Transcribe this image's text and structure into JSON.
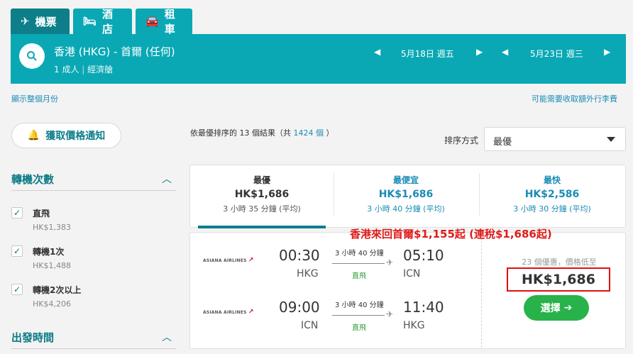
{
  "tabs": [
    {
      "label": "機票",
      "icon": "plane-icon"
    },
    {
      "label": "酒店",
      "icon": "bed-icon"
    },
    {
      "label": "租車",
      "icon": "car-icon"
    }
  ],
  "search": {
    "route": "香港 (HKG) - 首爾 (任何)",
    "passengers": "1 成人",
    "cabin": "經濟艙",
    "depart_date": "5月18日 週五",
    "return_date": "5月23日 週三"
  },
  "links": {
    "show_month": "顯示整個月份",
    "baggage_fees": "可能需要收取額外行李費"
  },
  "sidebar": {
    "alert_button": "獲取價格通知",
    "stops_title": "轉機次數",
    "stops": [
      {
        "label": "直飛",
        "price": "HK$1,383"
      },
      {
        "label": "轉機1次",
        "price": "HK$1,488"
      },
      {
        "label": "轉機2次以上",
        "price": "HK$4,206"
      }
    ],
    "departure_title": "出發時間"
  },
  "results": {
    "summary_prefix": "依最優排序的 13 個結果（共",
    "summary_count": "1424 個",
    "summary_suffix": "）",
    "sort_label": "排序方式",
    "sort_value": "最優"
  },
  "sort_tabs": [
    {
      "title": "最優",
      "price": "HK$1,686",
      "duration": "3 小時 35 分鐘 (平均)"
    },
    {
      "title": "最便宜",
      "price": "HK$1,686",
      "duration": "3 小時 40 分鐘 (平均)"
    },
    {
      "title": "最快",
      "price": "HK$2,586",
      "duration": "3 小時 30 分鐘 (平均)"
    }
  ],
  "promo": "香港來回首爾$1,155起 (連稅$1,686起)",
  "flight": {
    "outbound": {
      "airline": "ASIANA AIRLINES",
      "depart_time": "00:30",
      "depart_code": "HKG",
      "duration": "3 小時 40 分鐘",
      "stops": "直飛",
      "arrive_time": "05:10",
      "arrive_code": "ICN"
    },
    "inbound": {
      "airline": "ASIANA AIRLINES",
      "depart_time": "09:00",
      "depart_code": "ICN",
      "duration": "3 小時 40 分鐘",
      "stops": "直飛",
      "arrive_time": "11:40",
      "arrive_code": "HKG"
    },
    "offers_text": "23 個優惠，價格低至",
    "price": "HK$1,686",
    "select_label": "選擇"
  },
  "colors": {
    "teal": "#0aa8b5",
    "teal_dark": "#0d7e8a",
    "green_button": "#27b24a",
    "promo_red": "#e01a1a"
  }
}
